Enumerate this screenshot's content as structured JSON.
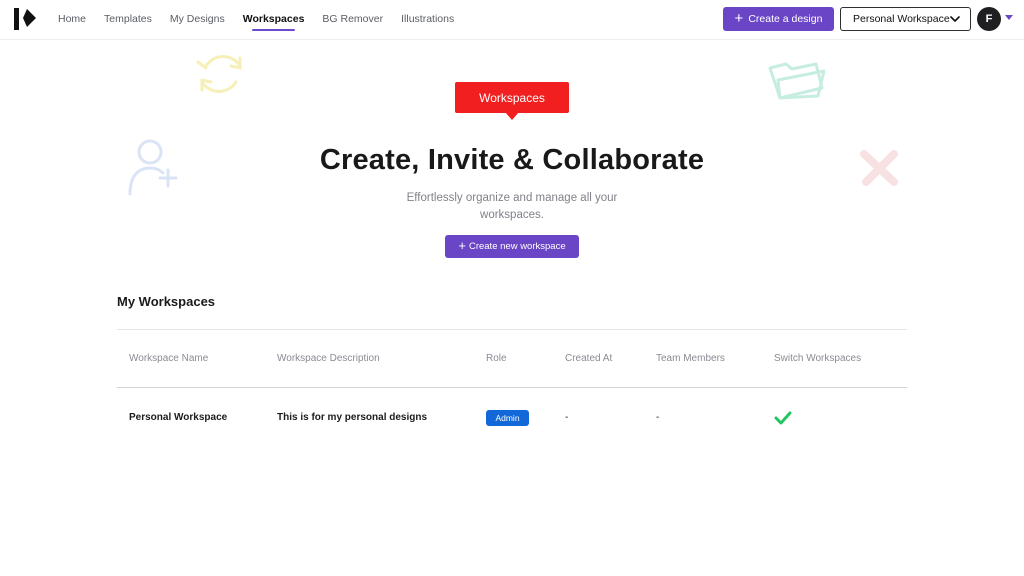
{
  "nav": {
    "items": [
      {
        "label": "Home"
      },
      {
        "label": "Templates"
      },
      {
        "label": "My Designs"
      },
      {
        "label": "Workspaces",
        "active": true
      },
      {
        "label": "BG Remover"
      },
      {
        "label": "Illustrations"
      }
    ],
    "create_button": "Create a design",
    "workspace_selector": "Personal Workspace",
    "avatar_initial": "F"
  },
  "hero": {
    "badge": "Workspaces",
    "title": "Create, Invite & Collaborate",
    "subtitle": "Effortlessly organize and manage all your workspaces.",
    "new_button": "Create new workspace"
  },
  "workspaces": {
    "section_title": "My Workspaces",
    "columns": [
      "Workspace Name",
      "Workspace Description",
      "Role",
      "Created At",
      "Team Members",
      "Switch Workspaces"
    ],
    "rows": [
      {
        "name": "Personal Workspace",
        "description": "This is for my personal designs",
        "role": "Admin",
        "created_at": "-",
        "team_members": "-",
        "switch": "check-icon"
      }
    ]
  },
  "colors": {
    "accent": "#6a45c6",
    "badge": "#f11f1f",
    "role_pill": "#1268d9",
    "check": "#22c55e"
  }
}
